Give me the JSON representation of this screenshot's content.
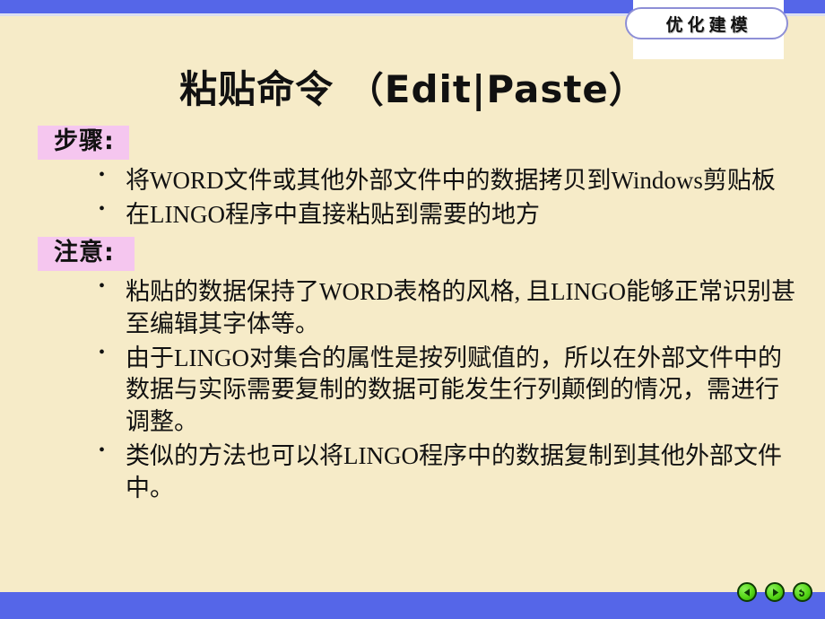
{
  "slide": {
    "badge": "优化建模",
    "title_cjk": "粘贴命令",
    "title_paren_open": "（",
    "title_en": "Edit|Paste",
    "title_paren_close": "）",
    "sections": [
      {
        "label": "步骤:",
        "bullets": [
          "将WORD文件或其他外部文件中的数据拷贝到Windows剪贴板",
          "在LINGO程序中直接粘贴到需要的地方"
        ]
      },
      {
        "label": "注意:",
        "bullets": [
          "粘贴的数据保持了WORD表格的风格, 且LINGO能够正常识别甚至编辑其字体等。",
          "由于LINGO对集合的属性是按列赋值的，所以在外部文件中的数据与实际需要复制的数据可能发生行列颠倒的情况，需进行调整。",
          "类似的方法也可以将LINGO程序中的数据复制到其他外部文件中。"
        ]
      }
    ],
    "nav": [
      {
        "name": "previous-slide-button",
        "icon": "triangle-left-icon"
      },
      {
        "name": "next-slide-button",
        "icon": "triangle-right-icon"
      },
      {
        "name": "return-home-button",
        "icon": "return-arrow-icon"
      }
    ],
    "colors": {
      "background": "#F6EBC8",
      "bar": "#5566E8",
      "label_highlight": "#F5C6EF",
      "nav_button": "#55D616",
      "badge_outline": "#8E8FD6"
    }
  }
}
